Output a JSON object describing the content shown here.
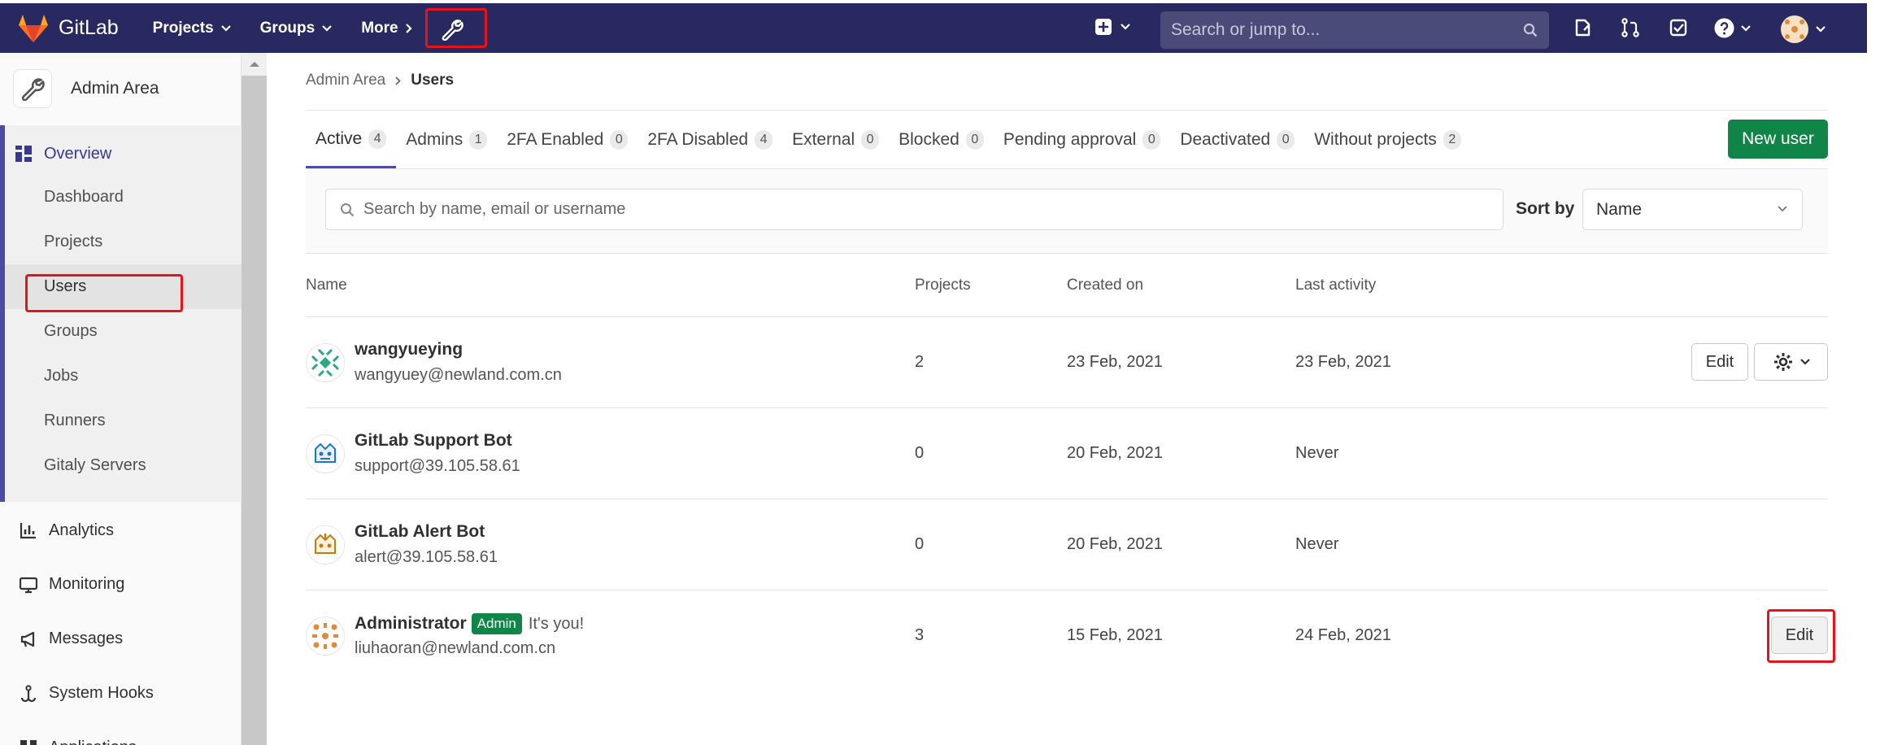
{
  "navbar": {
    "brand": "GitLab",
    "menus": [
      {
        "label": "Projects"
      },
      {
        "label": "Groups"
      },
      {
        "label": "More"
      }
    ],
    "search_placeholder": "Search or jump to...",
    "accent_color": "#292961"
  },
  "sidebar": {
    "title": "Admin Area",
    "section_label": "Overview",
    "items": [
      "Dashboard",
      "Projects",
      "Users",
      "Groups",
      "Jobs",
      "Runners",
      "Gitaly Servers"
    ],
    "active_item": "Users",
    "bottom_items": [
      "Analytics",
      "Monitoring",
      "Messages",
      "System Hooks",
      "Applications"
    ]
  },
  "breadcrumb": {
    "parent": "Admin Area",
    "current": "Users"
  },
  "tabs": [
    {
      "label": "Active",
      "count": "4"
    },
    {
      "label": "Admins",
      "count": "1"
    },
    {
      "label": "2FA Enabled",
      "count": "0"
    },
    {
      "label": "2FA Disabled",
      "count": "4"
    },
    {
      "label": "External",
      "count": "0"
    },
    {
      "label": "Blocked",
      "count": "0"
    },
    {
      "label": "Pending approval",
      "count": "0"
    },
    {
      "label": "Deactivated",
      "count": "0"
    },
    {
      "label": "Without projects",
      "count": "2"
    }
  ],
  "new_user_label": "New user",
  "filter": {
    "search_placeholder": "Search by name, email or username",
    "sort_label": "Sort by",
    "sort_value": "Name"
  },
  "table": {
    "headers": [
      "Name",
      "Projects",
      "Created on",
      "Last activity"
    ],
    "rows": [
      {
        "name": "wangyueying",
        "email": "wangyuey@newland.com.cn",
        "projects": "2",
        "created": "23 Feb, 2021",
        "last": "23 Feb, 2021"
      },
      {
        "name": "GitLab Support Bot",
        "email": "support@39.105.58.61",
        "projects": "0",
        "created": "20 Feb, 2021",
        "last": "Never"
      },
      {
        "name": "GitLab Alert Bot",
        "email": "alert@39.105.58.61",
        "projects": "0",
        "created": "20 Feb, 2021",
        "last": "Never"
      },
      {
        "name": "Administrator",
        "badge": "Admin",
        "note": "It's you!",
        "email": "liuhaoran@newland.com.cn",
        "projects": "3",
        "created": "15 Feb, 2021",
        "last": "24 Feb, 2021"
      }
    ]
  },
  "edit_label": "Edit"
}
